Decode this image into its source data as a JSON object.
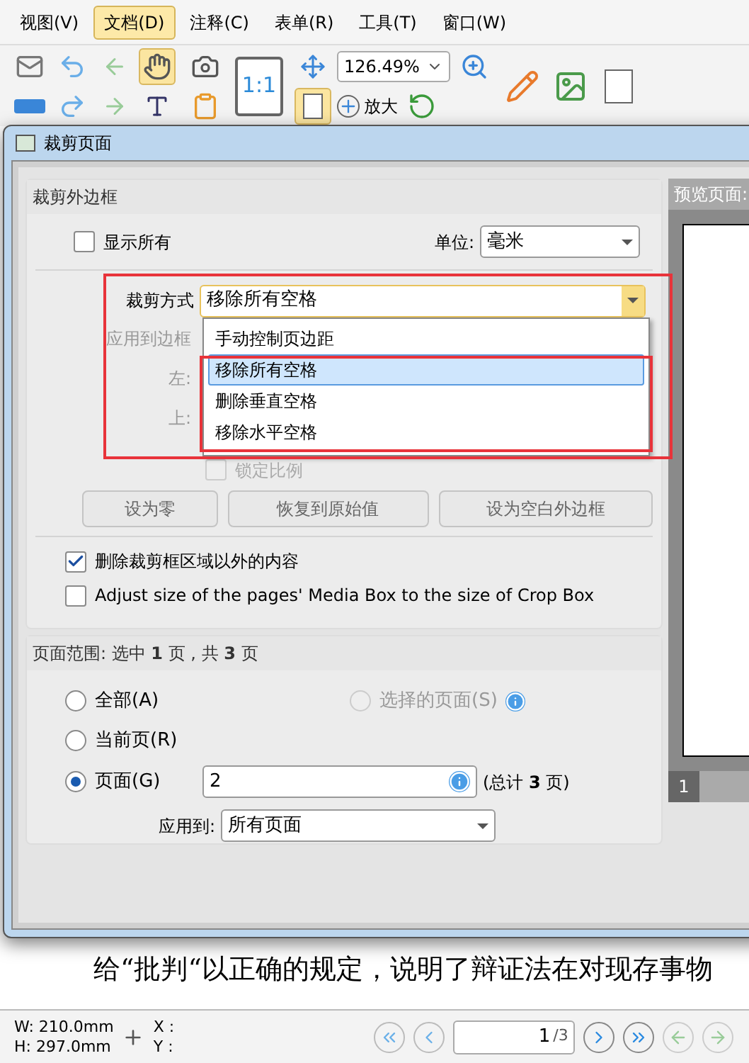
{
  "menu": [
    {
      "label": "视图(V)",
      "selected": false
    },
    {
      "label": "文档(D)",
      "selected": true
    },
    {
      "label": "注释(C)",
      "selected": false
    },
    {
      "label": "表单(R)",
      "selected": false
    },
    {
      "label": "工具(T)",
      "selected": false
    },
    {
      "label": "窗口(W)",
      "selected": false
    }
  ],
  "toolbar": {
    "zoom": "126.49%",
    "actual_size": "1:1",
    "zoom_in_label": "放大"
  },
  "dialog": {
    "title": "裁剪页面",
    "crop_group": {
      "title": "裁剪外边框",
      "show_all": {
        "label": "显示所有",
        "checked": false
      },
      "unit_label": "单位:",
      "unit": "毫米",
      "method_label": "裁剪方式",
      "method": "移除所有空格",
      "options": [
        {
          "label": "手动控制页边距",
          "selected": false
        },
        {
          "label": "移除所有空格",
          "selected": true
        },
        {
          "label": "删除垂直空格",
          "selected": false
        },
        {
          "label": "移除水平空格",
          "selected": false
        }
      ],
      "apply_border_label": "应用到边框",
      "left_label": "左:",
      "top_label": "上:",
      "lock_ratio": {
        "label": "锁定比例",
        "checked": false
      },
      "buttons": [
        "设为零",
        "恢复到原始值",
        "设为空白外边框"
      ],
      "checkboxes": [
        {
          "label": "删除裁剪框区域以外的内容",
          "checked": true
        },
        {
          "label": "Adjust size of the pages' Media Box to the size of Crop Box",
          "checked": false
        }
      ]
    },
    "range_group": {
      "title": "页面范围: 选中 **1** 页 , 共 **3** 页",
      "radios": [
        {
          "label": "全部(A)",
          "selected": false,
          "disabled": false
        },
        {
          "label": "选择的页面(S)",
          "selected": false,
          "disabled": true
        },
        {
          "label": "当前页(R)",
          "selected": false,
          "disabled": false
        },
        {
          "label": "页面(G)",
          "selected": true,
          "disabled": false
        }
      ],
      "pages_value": "2",
      "total": "(总计 **3** 页)",
      "apply_label": "应用到:",
      "apply_value": "所有页面"
    },
    "preview": {
      "title": "预览页面:",
      "page_number": "1"
    }
  },
  "document": {
    "lines": [
      "给“批判“以正确的规定，说明了辩证法在对现存事物"
    ]
  },
  "status_bar": {
    "width": "W: 210.0mm",
    "height": "H: 297.0mm",
    "x": "X :",
    "y": "Y :",
    "page": "1",
    "page_total": "/3"
  }
}
